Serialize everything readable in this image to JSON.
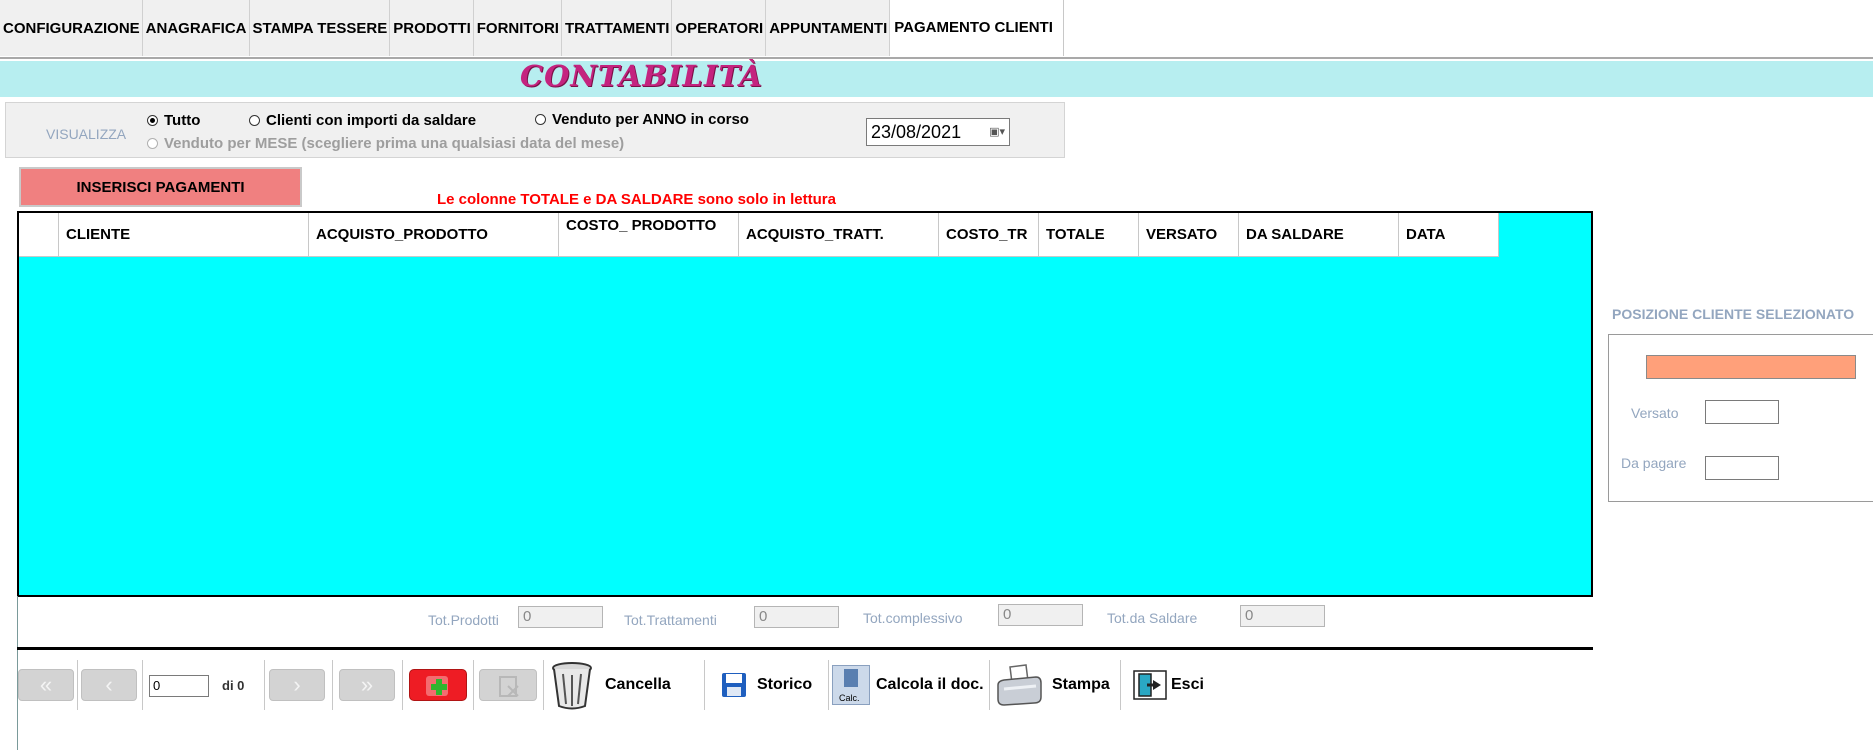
{
  "tabs": [
    {
      "label": "CONFIGURAZIONE",
      "active": false
    },
    {
      "label": "ANAGRAFICA",
      "active": false
    },
    {
      "label": "STAMPA TESSERE",
      "active": false
    },
    {
      "label": "PRODOTTI",
      "active": false
    },
    {
      "label": "FORNITORI",
      "active": false
    },
    {
      "label": "TRATTAMENTI",
      "active": false
    },
    {
      "label": "OPERATORI",
      "active": false
    },
    {
      "label": "APPUNTAMENTI",
      "active": false
    },
    {
      "label": "PAGAMENTO CLIENTI",
      "active": true
    }
  ],
  "banner": {
    "title": "CONTABILITÀ",
    "background": "#b7eef0",
    "title_color": "#c4237f"
  },
  "view": {
    "label": "VISUALIZZA",
    "options": [
      {
        "label": "Tutto",
        "checked": true,
        "enabled": true
      },
      {
        "label": "Clienti con importi da saldare",
        "checked": false,
        "enabled": true
      },
      {
        "label": "Venduto per ANNO in corso",
        "checked": false,
        "enabled": true
      },
      {
        "label": "Venduto per MESE (scegliere prima una qualsiasi data del mese)",
        "checked": false,
        "enabled": false
      }
    ],
    "date_value": "23/08/2021",
    "date_picker_icon": "calendar-dropdown-icon"
  },
  "insert_button": {
    "label": "INSERISCI PAGAMENTI",
    "color": "#f08080"
  },
  "readonly_note": "Le colonne TOTALE  e  DA SALDARE sono solo in lettura",
  "grid": {
    "background": "#00ffff",
    "columns": [
      "CLIENTE",
      "ACQUISTO_PRODOTTO",
      "COSTO_ PRODOTTO",
      "ACQUISTO_TRATT.",
      "COSTO_TR",
      "TOTALE",
      "VERSATO",
      "DA SALDARE",
      "DATA"
    ],
    "rows": []
  },
  "totals": {
    "prodotti": {
      "label": "Tot.Prodotti",
      "value": "0"
    },
    "trattamenti": {
      "label": "Tot.Trattamenti",
      "value": "0"
    },
    "complessivo": {
      "label": "Tot.complessivo",
      "value": "0"
    },
    "da_saldare": {
      "label": "Tot.da Saldare",
      "value": "0"
    }
  },
  "navigation": {
    "record_value": "0",
    "of_label": "di 0",
    "first_icon": "first-record-icon",
    "prev_icon": "previous-record-icon",
    "next_icon": "next-record-icon",
    "last_icon": "last-record-icon",
    "add_icon": "add-record-icon",
    "delete_icon": "delete-record-icon"
  },
  "toolbar": {
    "cancella": "Cancella",
    "storico": "Storico",
    "calcola": "Calcola il doc.",
    "calc_icon_text": "Calc.",
    "stampa": "Stampa",
    "esci": "Esci"
  },
  "client_position": {
    "title": "POSIZIONE CLIENTE SELEZIONATO",
    "client_color": "#ffa07a",
    "versato_label": "Versato",
    "versato_value": "",
    "da_pagare_label": "Da pagare",
    "da_pagare_value": ""
  }
}
